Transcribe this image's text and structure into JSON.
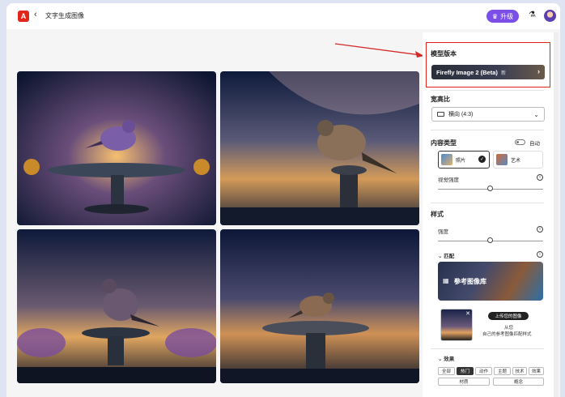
{
  "topbar": {
    "logo_text": "A",
    "back_icon": "‹",
    "title": "文字生成图像",
    "upgrade_label": "升级",
    "upgrade_icon": "crown-icon",
    "flask_icon": "flask-icon",
    "avatar_icon": "avatar"
  },
  "panel": {
    "model_section": "模型版本",
    "model_value": "Firefly Image 2 (Beta)",
    "model_badge": "新",
    "aspect_section": "宽高比",
    "aspect_value": "横向 (4:3)",
    "content_section": "内容类型",
    "auto_label": "自动",
    "content_options": [
      "照片",
      "艺术"
    ],
    "visual_intensity_label": "视觉强度",
    "style_section": "样式",
    "strength_label": "强度",
    "match_section": "匹配",
    "gallery_label": "参考图像库",
    "upload_button": "上传您的图像",
    "upload_hint_1": "从您",
    "upload_hint_2": "自己的参考图像匹配样式",
    "effects_section": "效果",
    "effect_chips_row1": [
      "全部",
      "热门",
      "动作",
      "主题",
      "技术",
      "效果"
    ],
    "effect_chips_row2": [
      "材质",
      "概念"
    ]
  },
  "colors": {
    "accent": "#7b4ee8",
    "logo_red": "#e1251b",
    "highlight_red": "#e2231a"
  }
}
